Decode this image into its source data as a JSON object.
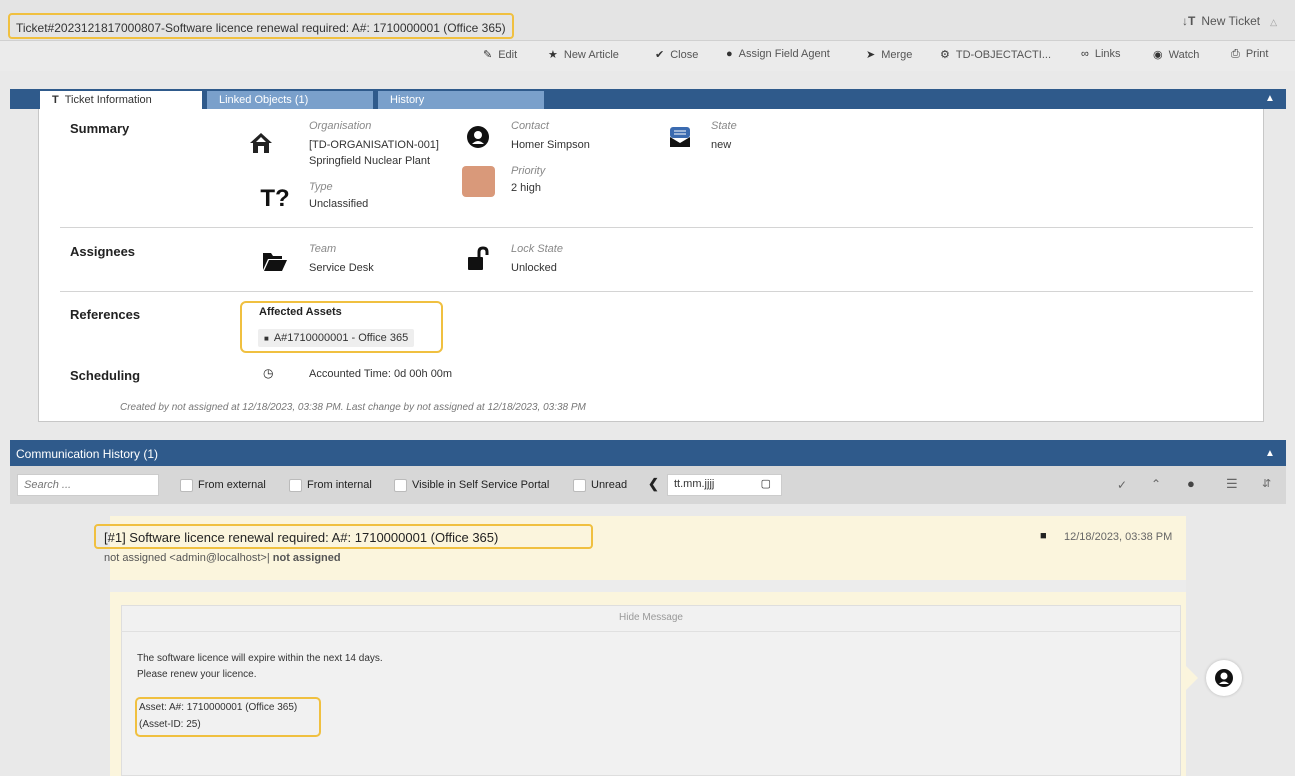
{
  "window": {
    "title": "Ticket#2023121817000807-Software licence renewal required: A#: 1710000001 (Office 365)",
    "new_ticket": "New Ticket"
  },
  "toolbar": [
    {
      "label": "Edit",
      "icon": "pencil-icon"
    },
    {
      "label": "New Article",
      "icon": "pin-icon"
    },
    {
      "label": "Close",
      "icon": "check-icon"
    },
    {
      "label": "Assign Field Agent",
      "icon": "agent-icon"
    },
    {
      "label": "Merge",
      "icon": "merge-icon"
    },
    {
      "label": "TD-OBJECTACTI...",
      "icon": "cogs-icon"
    },
    {
      "label": "Links",
      "icon": "link-icon"
    },
    {
      "label": "Watch",
      "icon": "eye-icon"
    },
    {
      "label": "Print",
      "icon": "print-icon"
    }
  ],
  "tabs": [
    {
      "label": "Ticket Information",
      "icon": "T"
    },
    {
      "label": "Linked Objects (1)"
    },
    {
      "label": "History"
    }
  ],
  "summary": {
    "label": "Summary",
    "organisation_label": "Organisation",
    "organisation_value_1": "[TD-ORGANISATION-001]",
    "organisation_value_2": "Springfield Nuclear Plant",
    "type_label": "Type",
    "type_value": "Unclassified",
    "contact_label": "Contact",
    "contact_value": "Homer Simpson",
    "priority_label": "Priority",
    "priority_value": "2 high",
    "priority_color": "#d9997a",
    "state_label": "State",
    "state_value": "new"
  },
  "assignees": {
    "label": "Assignees",
    "team_label": "Team",
    "team_value": "Service Desk",
    "lock_label": "Lock State",
    "lock_value": "Unlocked"
  },
  "references": {
    "label": "References",
    "affected_assets_label": "Affected Assets",
    "asset_value": "A#1710000001 - Office 365"
  },
  "scheduling": {
    "label": "Scheduling",
    "accounted_time": "Accounted Time: 0d 00h 00m"
  },
  "created_line": "Created by not assigned at 12/18/2023, 03:38 PM. Last change by not assigned at 12/18/2023, 03:38 PM",
  "comm": {
    "title": "Communication History (1)",
    "search_placeholder": "Search ...",
    "filters": [
      "From external",
      "From internal",
      "Visible in Self Service Portal",
      "Unread"
    ],
    "date_placeholder": "tt.mm.jjjj"
  },
  "article": {
    "title": "[#1] Software licence renewal required: A#: 1710000001 (Office 365)",
    "from_prefix": "not assigned <admin@localhost>|",
    "to": "not assigned",
    "timestamp": "12/18/2023, 03:38 PM",
    "hide_message": "Hide Message",
    "body_line_1": "The software licence will expire within the next 14 days.",
    "body_line_2": "Please renew your licence.",
    "asset_line_1": "Asset: A#: 1710000001 (Office 365)",
    "asset_line_2": "(Asset-ID: 25)"
  },
  "colors": {
    "header_blue": "#2f5a8b",
    "highlight": "#f0c040",
    "article_bg": "#fbf5dd"
  }
}
